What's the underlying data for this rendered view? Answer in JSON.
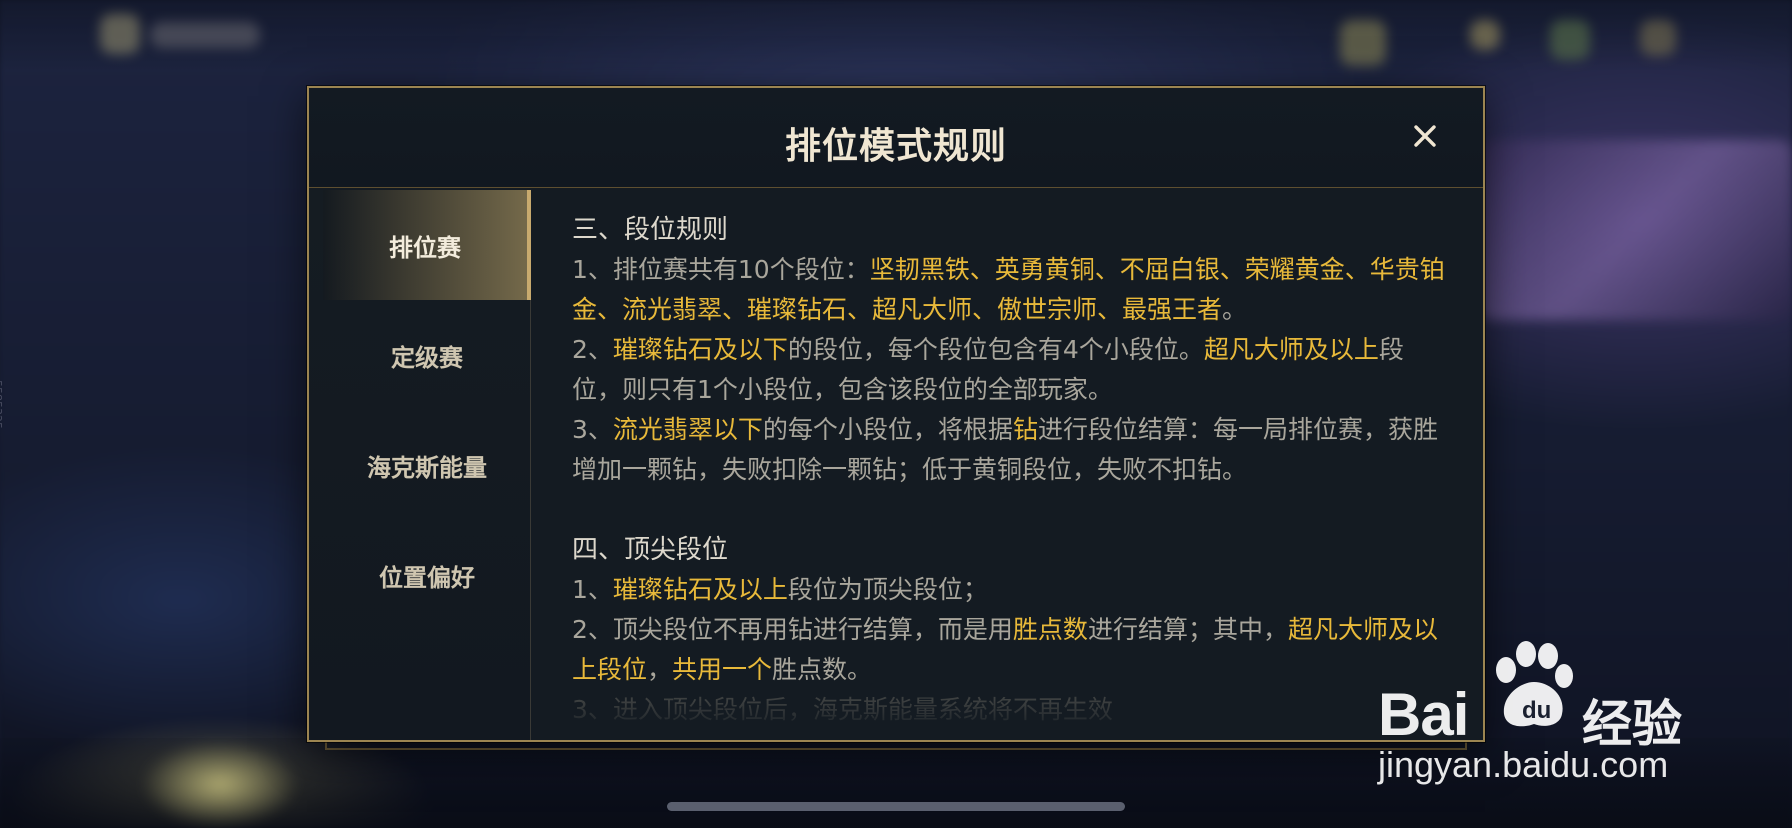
{
  "dialog": {
    "title": "排位模式规则"
  },
  "tabs": [
    {
      "label": "排位赛",
      "active": true
    },
    {
      "label": "定级赛",
      "active": false
    },
    {
      "label": "海克斯能量",
      "active": false
    },
    {
      "label": "位置偏好",
      "active": false
    }
  ],
  "content": {
    "s3_title": "三、段位规则",
    "s3_p1_a": "1、排位赛共有10个段位：",
    "s3_p1_tiers": "坚韧黑铁、英勇黄铜、不屈白银、荣耀黄金、华贵铂金、流光翡翠、璀璨钻石、超凡大师、傲世宗师、最强王者",
    "s3_p1_b": "。",
    "s3_p2_hl1": "璀璨钻石及以下",
    "s3_p2_a": "的段位，每个段位包含有4个小段位。",
    "s3_p2_hl2": "超凡大师及以上",
    "s3_p2_b": "段位，则只有1个小段位，包含该段位的全部玩家。",
    "s3_p3_a": "3、",
    "s3_p3_hl1": "流光翡翠以下",
    "s3_p3_b": "的每个小段位，将根据",
    "s3_p3_hl2": "钻",
    "s3_p3_c": "进行段位结算：每一局排位赛，获胜增加一颗钻，失败扣除一颗钻；低于黄铜段位，失败不扣钻。",
    "s3_p2_prefix": "2、",
    "s4_title": "四、顶尖段位",
    "s4_p1_a": "1、",
    "s4_p1_hl": "璀璨钻石及以上",
    "s4_p1_b": "段位为顶尖段位；",
    "s4_p2_a": "2、顶尖段位不再用钻进行结算，而是用",
    "s4_p2_hl1": "胜点数",
    "s4_p2_b": "进行结算；其中，",
    "s4_p2_hl2": "超凡大师及以上段位",
    "s4_p2_c": "，",
    "s4_p2_hl3": "共用一个",
    "s4_p2_d": "胜点数。",
    "s4_p3_partial": "3、进入顶尖段位后，海克斯能量系统将不再生效"
  },
  "side_id": "5585325",
  "watermark": {
    "brand": "Bai",
    "brand_du": "du",
    "cn": "经验",
    "url": "jingyan.baidu.com"
  },
  "colors": {
    "accent_gold": "#e8b93a",
    "border_gold": "#9c8551",
    "panel_bg": "#141b22"
  }
}
